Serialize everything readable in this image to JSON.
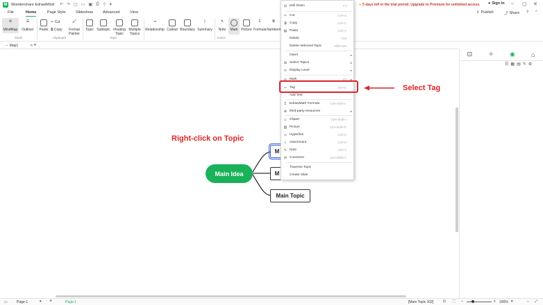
{
  "titlebar": {
    "app_name": "Wondershare EdrawMind",
    "trial_text": "5 days left in the trial period. Upgrade to Premium for unlimited access.",
    "sign_in": "Sign In"
  },
  "menu": {
    "tabs": [
      "File",
      "Home",
      "Page Style",
      "Slideshow",
      "Advanced",
      "View"
    ],
    "active": "Home",
    "publish": "Publish",
    "share": "Share"
  },
  "ribbon": {
    "mindmap": "MindMap",
    "outliner": "Outliner",
    "mode_label": "Mode",
    "paste": "Paste",
    "cut": "Cut",
    "copy": "Copy",
    "format_painter_1": "Format",
    "format_painter_2": "Painter",
    "clipboard_label": "Clipboard",
    "topic": "Topic",
    "subtopic": "Subtopic",
    "floating_1": "Floating",
    "floating_2": "Topic",
    "multiple_1": "Multiple",
    "multiple_2": "Topics",
    "topic_label": "Topic",
    "relationship": "Relationship",
    "callout": "Callout",
    "boundary": "Boundary",
    "summary": "Summary",
    "note": "Note",
    "mark": "Mark",
    "picture": "Picture",
    "formula": "Formula",
    "numbering": "Numbering",
    "insert_label": "Insert"
  },
  "doc": {
    "tab_name": "Map1"
  },
  "canvas": {
    "main_idea": "Main Idea",
    "topic_1": "M",
    "topic_2": "M",
    "topic_3": "Main Topic",
    "annotation_right_click": "Right-click on Topic",
    "annotation_select_tag": "Select Tag"
  },
  "context_menu": {
    "items": [
      {
        "icon": "drill",
        "label": "Drill Down",
        "shortcut": "F4"
      },
      {
        "icon": "cut",
        "label": "Cut",
        "shortcut": "Ctrl+X"
      },
      {
        "icon": "copy",
        "label": "Copy",
        "shortcut": "Ctrl+C"
      },
      {
        "icon": "paste",
        "label": "Paste",
        "shortcut": "Ctrl+V"
      },
      {
        "icon": "",
        "label": "Delete",
        "shortcut": "Del"
      },
      {
        "icon": "",
        "label": "Delete Selected Topic",
        "shortcut": "Shift+Del"
      },
      {
        "icon": "",
        "label": "Insert",
        "shortcut": ""
      },
      {
        "icon": "topics",
        "label": "Select Topics",
        "shortcut": ""
      },
      {
        "icon": "display",
        "label": "Display Level",
        "shortcut": ""
      },
      {
        "icon": "mark",
        "label": "Mark",
        "shortcut": "F6"
      },
      {
        "icon": "tag",
        "label": "Tag",
        "shortcut": "Ctrl+G"
      },
      {
        "icon": "",
        "label": "Add Text",
        "shortcut": ""
      },
      {
        "icon": "sigma",
        "label": "EdrawMath Formula",
        "shortcut": "Ctrl+Shift+L"
      },
      {
        "icon": "puzzle",
        "label": "third-party resources",
        "shortcut": ""
      },
      {
        "icon": "clipart",
        "label": "Clipart",
        "shortcut": "Ctrl+Shift+I"
      },
      {
        "icon": "picture",
        "label": "Picture",
        "shortcut": "Ctrl+Shift+P"
      },
      {
        "icon": "link",
        "label": "Hyperlink",
        "shortcut": "Ctrl+K"
      },
      {
        "icon": "attach",
        "label": "Attachment",
        "shortcut": "Ctrl+H"
      },
      {
        "icon": "note",
        "label": "Note",
        "shortcut": "Ctrl+T"
      },
      {
        "icon": "comment",
        "label": "Comment",
        "shortcut": "Ctrl+Shift+T"
      },
      {
        "icon": "",
        "label": "Traverse Topic",
        "shortcut": ""
      },
      {
        "icon": "",
        "label": "Create Slide",
        "shortcut": ""
      }
    ]
  },
  "statusbar": {
    "page_select": "Page-1",
    "page_tab": "Page-1",
    "selection_info": "[Main Topic 102]",
    "zoom": "100%"
  },
  "colors": {
    "brand_green": "#19b15a",
    "annotation_red": "#e02424"
  }
}
